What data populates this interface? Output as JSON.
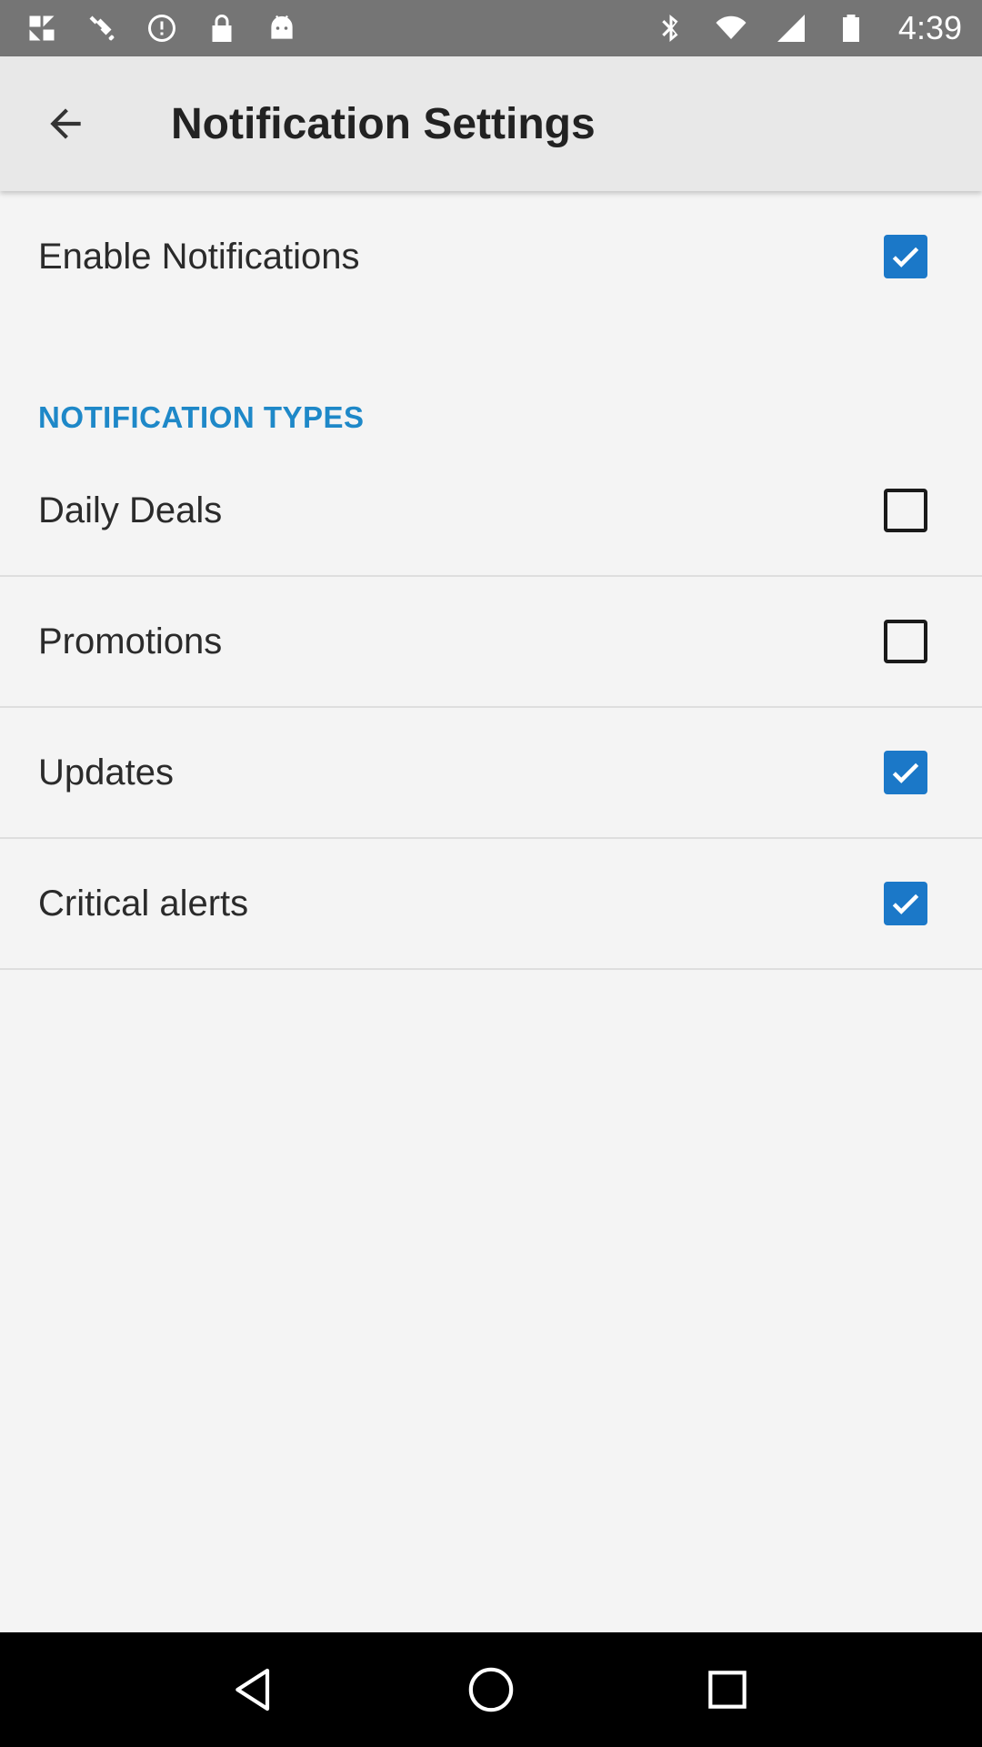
{
  "status_bar": {
    "time": "4:39",
    "left_icons": [
      "fake-gps-icon",
      "satellite-icon",
      "sync-icon",
      "lock-icon",
      "android-icon"
    ],
    "right_icons": [
      "bluetooth-icon",
      "wifi-icon",
      "signal-icon",
      "battery-icon"
    ]
  },
  "app_bar": {
    "title": "Notification Settings",
    "back_icon": "arrow-back-icon"
  },
  "settings": {
    "enable": {
      "label": "Enable Notifications",
      "checked": true
    },
    "section_header": "NOTIFICATION TYPES",
    "types": [
      {
        "label": "Daily Deals",
        "checked": false
      },
      {
        "label": "Promotions",
        "checked": false
      },
      {
        "label": "Updates",
        "checked": true
      },
      {
        "label": "Critical alerts",
        "checked": true
      }
    ]
  },
  "colors": {
    "accent": "#1b78c8",
    "section_header": "#1e88c8",
    "status_bar": "#757575",
    "app_bar": "#e8e8e8",
    "background": "#f4f4f4"
  },
  "nav_bar": {
    "buttons": [
      "back-triangle-icon",
      "home-circle-icon",
      "recents-square-icon"
    ]
  }
}
